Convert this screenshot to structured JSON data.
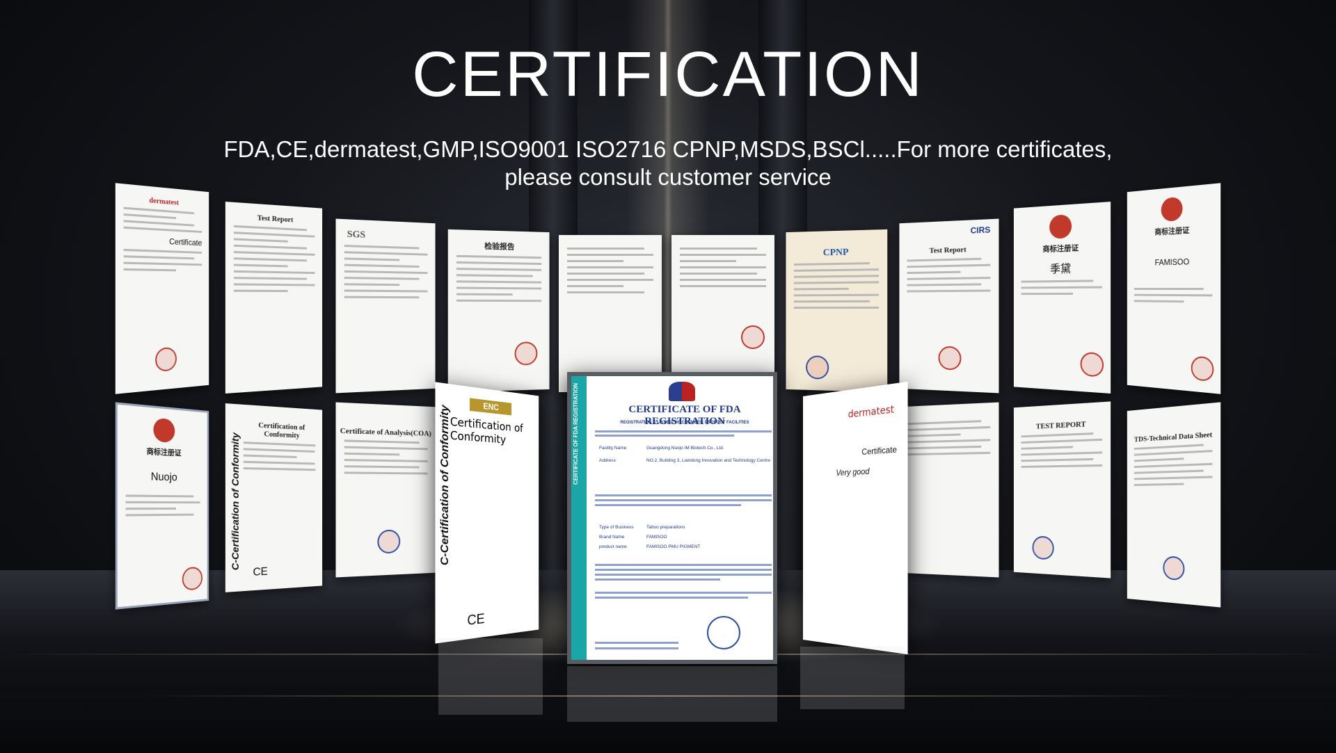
{
  "title": "CERTIFICATION",
  "subtitle": "FDA,CE,dermatest,GMP,ISO9001 ISO2716 CPNP,MSDS,BSCl.....For more certificates, please consult customer service",
  "top_row": [
    {
      "header": "dermatest",
      "side": "Certificate"
    },
    {
      "header": "Test Report"
    },
    {
      "header": "SGS"
    },
    {
      "header": "检验报告"
    },
    {
      "header": ""
    },
    {
      "header": ""
    },
    {
      "header": "CPNP"
    },
    {
      "header": "Test Report",
      "logo": "CIRS"
    },
    {
      "header": "商标注册证",
      "brand": "季黛"
    },
    {
      "header": "商标注册证",
      "brand": "FAMISOO"
    }
  ],
  "bottom_row": [
    {
      "header": "商标注册证",
      "brand": "Nuojo"
    },
    {
      "header": "Certification of Conformity",
      "vertical": "C-Certification of Conformity",
      "mark": "CE"
    },
    {
      "header": "Certificate of Analysis(COA)"
    },
    {
      "header": "TEST REPORT"
    },
    {
      "header": "TDS-Technical Data Sheet"
    }
  ],
  "fda_certificate": {
    "title": "CERTIFICATE OF FDA REGISTRATION",
    "subtitle": "REGISTRATION & LISTING OF COSMETIC PRODUCT FACILITIES",
    "side_text": "CERTIFICATE OF FDA REGISTRATION",
    "fields": [
      {
        "label": "Facility Name",
        "value": "Guangdong Nuojo IM Biotech Co., Ltd."
      },
      {
        "label": "Address",
        "value": "NO.2, Building 3, Liandong Innovation and Technology Centre"
      },
      {
        "label": "Type of Business",
        "value": "Tattoo preparations"
      },
      {
        "label": "Brand Name",
        "value": "FAMISOO"
      },
      {
        "label": "product name",
        "value": "FAMISOO PMU PIGMENT"
      }
    ]
  },
  "enc_certificate": {
    "header": "Certification of Conformity",
    "logo": "ENC",
    "vertical": "C-Certification of Conformity",
    "mark": "CE"
  },
  "derm_certificate": {
    "header": "dermatest",
    "side": "Certificate",
    "grade": "Very good"
  }
}
